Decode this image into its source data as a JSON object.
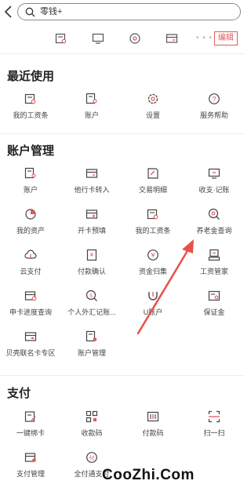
{
  "search": {
    "query": "零钱+"
  },
  "header": {
    "edit_label": "编辑",
    "more_dots": "• • •"
  },
  "sections": {
    "recent": {
      "title": "最近使用",
      "items": [
        {
          "label": "我的工资条",
          "icon": "payslip-icon"
        },
        {
          "label": "账户",
          "icon": "account-icon"
        },
        {
          "label": "设置",
          "icon": "gear-icon"
        },
        {
          "label": "服务帮助",
          "icon": "help-icon"
        }
      ]
    },
    "account": {
      "title": "账户管理",
      "items": [
        {
          "label": "账户",
          "icon": "account-icon"
        },
        {
          "label": "他行卡转入",
          "icon": "card-transfer-icon"
        },
        {
          "label": "交易明细",
          "icon": "transaction-detail-icon"
        },
        {
          "label": "收支·记账",
          "icon": "bookkeeping-icon"
        },
        {
          "label": "我的资产",
          "icon": "pie-chart-icon"
        },
        {
          "label": "开卡预填",
          "icon": "card-prefill-icon"
        },
        {
          "label": "我的工资条",
          "icon": "payslip-icon"
        },
        {
          "label": "养老金查询",
          "icon": "pension-search-icon"
        },
        {
          "label": "云支付",
          "icon": "cloud-pay-icon"
        },
        {
          "label": "付款确认",
          "icon": "payment-confirm-icon"
        },
        {
          "label": "资金归集",
          "icon": "fund-collect-icon"
        },
        {
          "label": "工资管家",
          "icon": "salary-manager-icon"
        },
        {
          "label": "申卡进度查询",
          "icon": "card-progress-icon"
        },
        {
          "label": "个人外汇记账...",
          "icon": "forex-icon"
        },
        {
          "label": "U账户",
          "icon": "u-account-icon"
        },
        {
          "label": "保证金",
          "icon": "deposit-icon"
        },
        {
          "label": "贝壳联名卡专区",
          "icon": "co-brand-card-icon"
        },
        {
          "label": "账户管理",
          "icon": "account-manage-icon"
        }
      ]
    },
    "payment": {
      "title": "支付",
      "items": [
        {
          "label": "一键绑卡",
          "icon": "bind-card-icon"
        },
        {
          "label": "收款码",
          "icon": "qr-code-icon"
        },
        {
          "label": "付款码",
          "icon": "barcode-icon"
        },
        {
          "label": "扫一扫",
          "icon": "scan-icon"
        },
        {
          "label": "支付管理",
          "icon": "pay-manage-icon"
        },
        {
          "label": "全付通支付",
          "icon": "full-pay-icon"
        }
      ]
    }
  },
  "watermark": "CooZhi.Com",
  "colors": {
    "accent": "#e05a5a",
    "icon_stroke": "#444444",
    "arrow": "#e8504a"
  }
}
